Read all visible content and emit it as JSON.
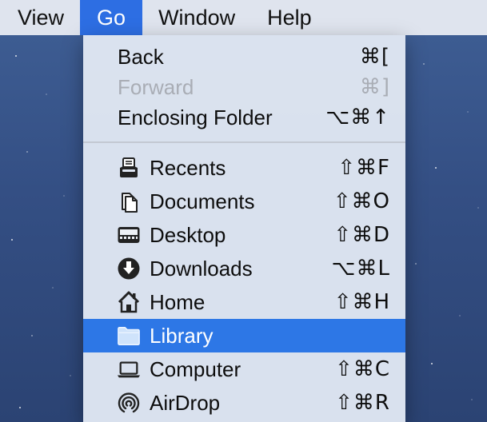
{
  "menubar": {
    "items": [
      {
        "label": "View"
      },
      {
        "label": "Go"
      },
      {
        "label": "Window"
      },
      {
        "label": "Help"
      }
    ],
    "active_item": "Go"
  },
  "go_menu": {
    "items": [
      {
        "label": "Back",
        "shortcut": "⌘[",
        "enabled": true
      },
      {
        "label": "Forward",
        "shortcut": "⌘]",
        "enabled": false
      },
      {
        "label": "Enclosing Folder",
        "shortcut": "⌥⌘↑",
        "enabled": true
      },
      {
        "label": "Recents",
        "shortcut": "⇧⌘F",
        "icon": "recents-tray-icon"
      },
      {
        "label": "Documents",
        "shortcut": "⇧⌘O",
        "icon": "documents-icon"
      },
      {
        "label": "Desktop",
        "shortcut": "⇧⌘D",
        "icon": "desktop-icon"
      },
      {
        "label": "Downloads",
        "shortcut": "⌥⌘L",
        "icon": "downloads-icon"
      },
      {
        "label": "Home",
        "shortcut": "⇧⌘H",
        "icon": "home-icon"
      },
      {
        "label": "Library",
        "shortcut": "",
        "icon": "folder-icon",
        "selected": true
      },
      {
        "label": "Computer",
        "shortcut": "⇧⌘C",
        "icon": "computer-icon"
      },
      {
        "label": "AirDrop",
        "shortcut": "⇧⌘R",
        "icon": "airdrop-icon"
      }
    ]
  },
  "colors": {
    "menubar_bg": "#dfe4ee",
    "highlight": "#2d77e6",
    "disabled_text": "#a9adb5",
    "desktop_bg": "#344f84"
  }
}
